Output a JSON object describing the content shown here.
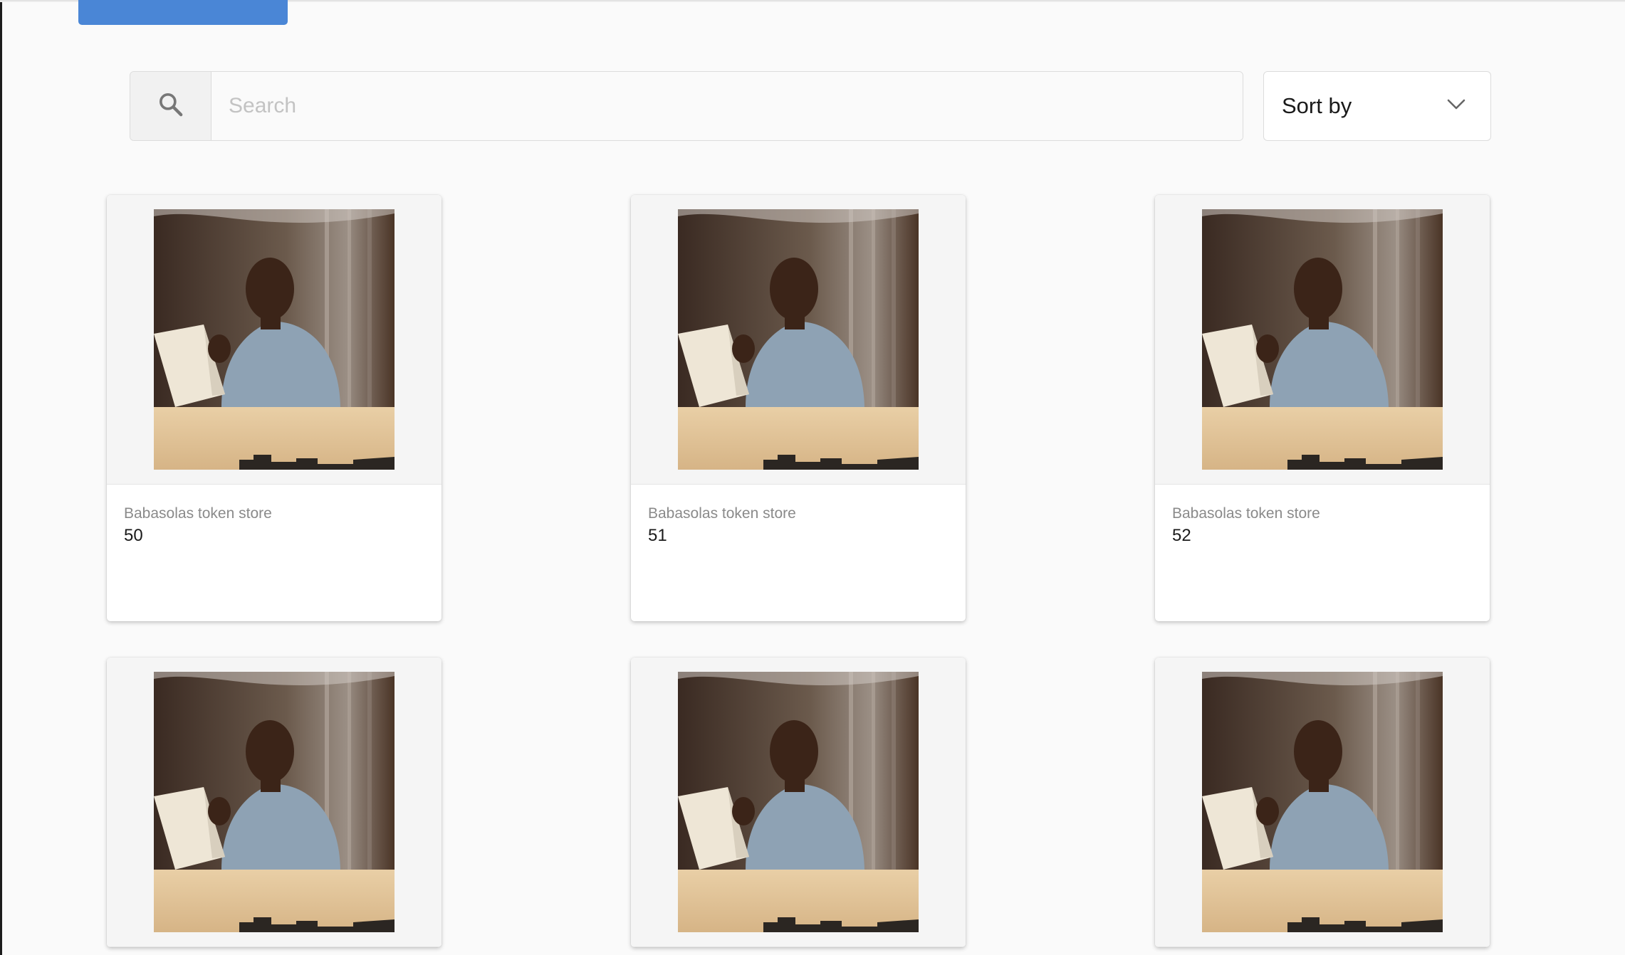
{
  "search": {
    "placeholder": "Search",
    "value": ""
  },
  "sort": {
    "label": "Sort by"
  },
  "cards": [
    {
      "store": "Babasolas token store",
      "number": "50"
    },
    {
      "store": "Babasolas token store",
      "number": "51"
    },
    {
      "store": "Babasolas token store",
      "number": "52"
    },
    {
      "store": "",
      "number": ""
    },
    {
      "store": "",
      "number": ""
    },
    {
      "store": "",
      "number": ""
    }
  ],
  "colors": {
    "accent": "#4a86d6",
    "background": "#fafafa",
    "card_border": "#dcdcdc"
  }
}
